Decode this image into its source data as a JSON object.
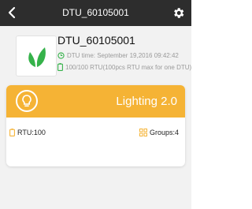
{
  "header": {
    "title": "DTU_60105001"
  },
  "dtu": {
    "name": "DTU_60105001",
    "time_text": "DTU time: September 19,2016  09:42:42",
    "rtu_text": "100/100 RTU(100pcs RTU max for one DTU)"
  },
  "card": {
    "title": "Lighting 2.0",
    "rtu": "RTU:100",
    "groups": "Groups:4"
  },
  "colors": {
    "header_bg": "#2d2d2d",
    "card_accent": "#f5b335",
    "green": "#35b24a"
  },
  "icons": {
    "back": "chevron-left",
    "settings": "gear",
    "logo": "leaf",
    "time": "clock",
    "capacity": "battery",
    "card": "lightbulb",
    "rtu": "battery",
    "groups": "grid"
  }
}
